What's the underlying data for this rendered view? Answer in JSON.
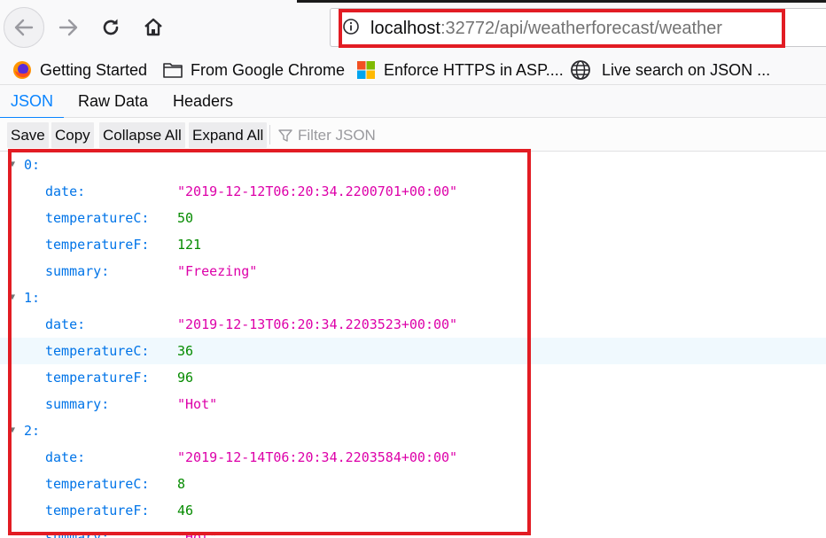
{
  "browser": {
    "url_host": "localhost",
    "url_rest": ":32772/api/weatherforecast/weather",
    "highlight_color": "#e21c23"
  },
  "bookmarks": [
    {
      "label": "Getting Started",
      "icon": "firefox-icon"
    },
    {
      "label": "From Google Chrome",
      "icon": "folder-icon"
    },
    {
      "label": "Enforce HTTPS in ASP....",
      "icon": "microsoft-icon"
    },
    {
      "label": "Live search on JSON ...",
      "icon": "globe-icon"
    }
  ],
  "tabs": [
    "JSON",
    "Raw Data",
    "Headers"
  ],
  "toolbar": {
    "save": "Save",
    "copy": "Copy",
    "collapse_all": "Collapse All",
    "expand_all": "Expand All",
    "filter_placeholder": "Filter JSON"
  },
  "json": [
    {
      "index": "0:",
      "fields": [
        {
          "key": "date:",
          "value": "\"2019-12-12T06:20:34.2200701+00:00\"",
          "type": "str"
        },
        {
          "key": "temperatureC:",
          "value": "50",
          "type": "num"
        },
        {
          "key": "temperatureF:",
          "value": "121",
          "type": "num"
        },
        {
          "key": "summary:",
          "value": "\"Freezing\"",
          "type": "str"
        }
      ]
    },
    {
      "index": "1:",
      "fields": [
        {
          "key": "date:",
          "value": "\"2019-12-13T06:20:34.2203523+00:00\"",
          "type": "str"
        },
        {
          "key": "temperatureC:",
          "value": "36",
          "type": "num"
        },
        {
          "key": "temperatureF:",
          "value": "96",
          "type": "num"
        },
        {
          "key": "summary:",
          "value": "\"Hot\"",
          "type": "str"
        }
      ]
    },
    {
      "index": "2:",
      "fields": [
        {
          "key": "date:",
          "value": "\"2019-12-14T06:20:34.2203584+00:00\"",
          "type": "str"
        },
        {
          "key": "temperatureC:",
          "value": "8",
          "type": "num"
        },
        {
          "key": "temperatureF:",
          "value": "46",
          "type": "num"
        },
        {
          "key": "summary:",
          "value": "\"Hot\"",
          "type": "str"
        }
      ]
    }
  ]
}
